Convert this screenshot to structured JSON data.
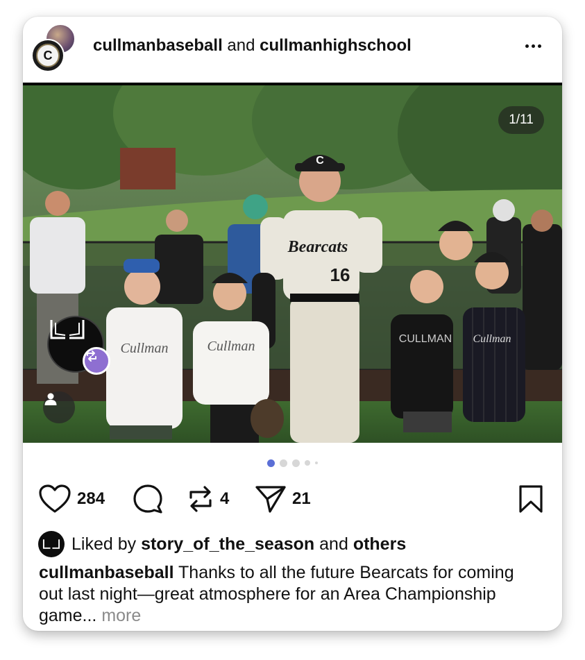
{
  "post": {
    "author": "cullmanbaseball",
    "joiner": "and",
    "coauthor": "cullmanhighschool",
    "avatar_letter": "C",
    "more_icon": "ellipsis-horizontal-icon"
  },
  "media": {
    "page_indicator": "1/11",
    "total_slides": 11,
    "current_slide": 1,
    "jersey_text": "Bearcats",
    "jersey_number": "16",
    "cap_letter": "C"
  },
  "actions": {
    "likes": "284",
    "reposts": "4",
    "shares": "21"
  },
  "liked_by": {
    "prefix": "Liked by",
    "user": "story_of_the_season",
    "joiner": "and",
    "others": "others"
  },
  "caption": {
    "author": "cullmanbaseball",
    "text": "Thanks to all the future Bearcats for coming out last night—great atmosphere for an Area Championship game...",
    "more": "more"
  },
  "colors": {
    "accent": "#8e6fd1",
    "active_dot": "#5b6fd6"
  }
}
